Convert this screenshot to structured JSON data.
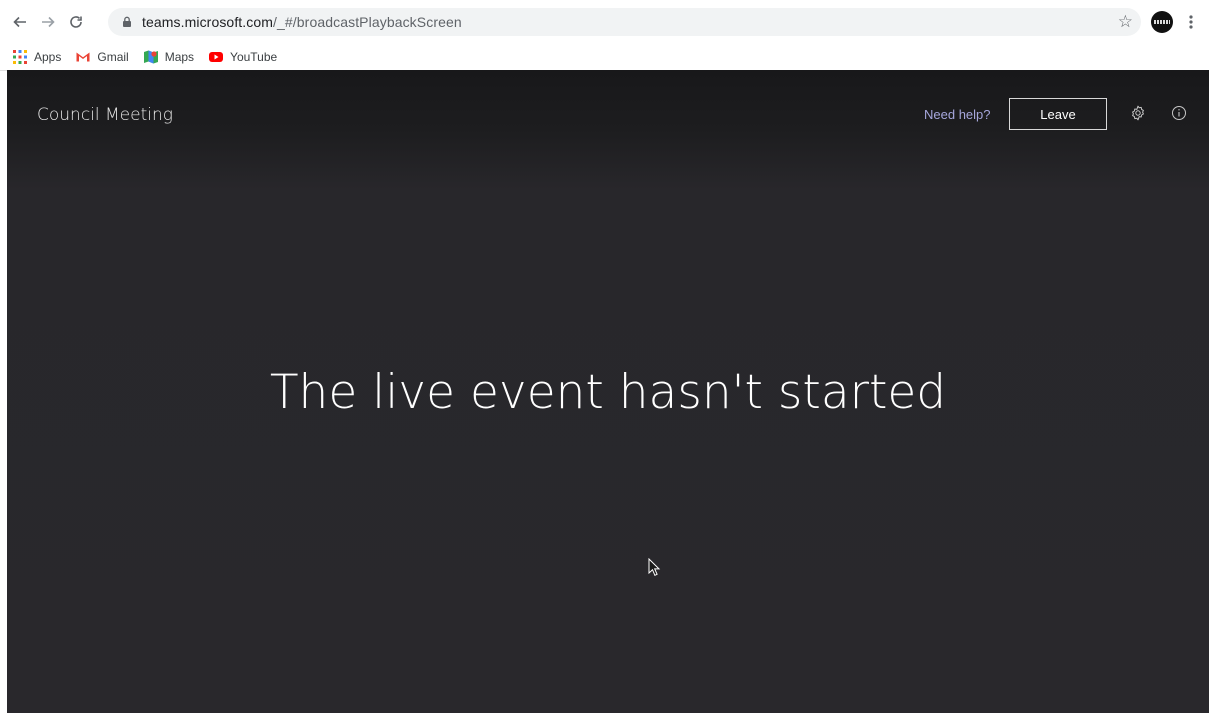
{
  "browser": {
    "url_host": "teams.microsoft.com",
    "url_path": "/_#/broadcastPlaybackScreen",
    "bookmarks": [
      {
        "label": "Apps",
        "icon": "apps-grid-icon"
      },
      {
        "label": "Gmail",
        "icon": "gmail-icon"
      },
      {
        "label": "Maps",
        "icon": "maps-icon"
      },
      {
        "label": "YouTube",
        "icon": "youtube-icon"
      }
    ]
  },
  "header": {
    "title": "Council Meeting",
    "help_link": "Need help?",
    "leave_label": "Leave"
  },
  "main": {
    "status_message": "The live event hasn't started"
  },
  "colors": {
    "background": "#29282c",
    "help_link": "#a6a7dc",
    "text": "#ffffff"
  }
}
